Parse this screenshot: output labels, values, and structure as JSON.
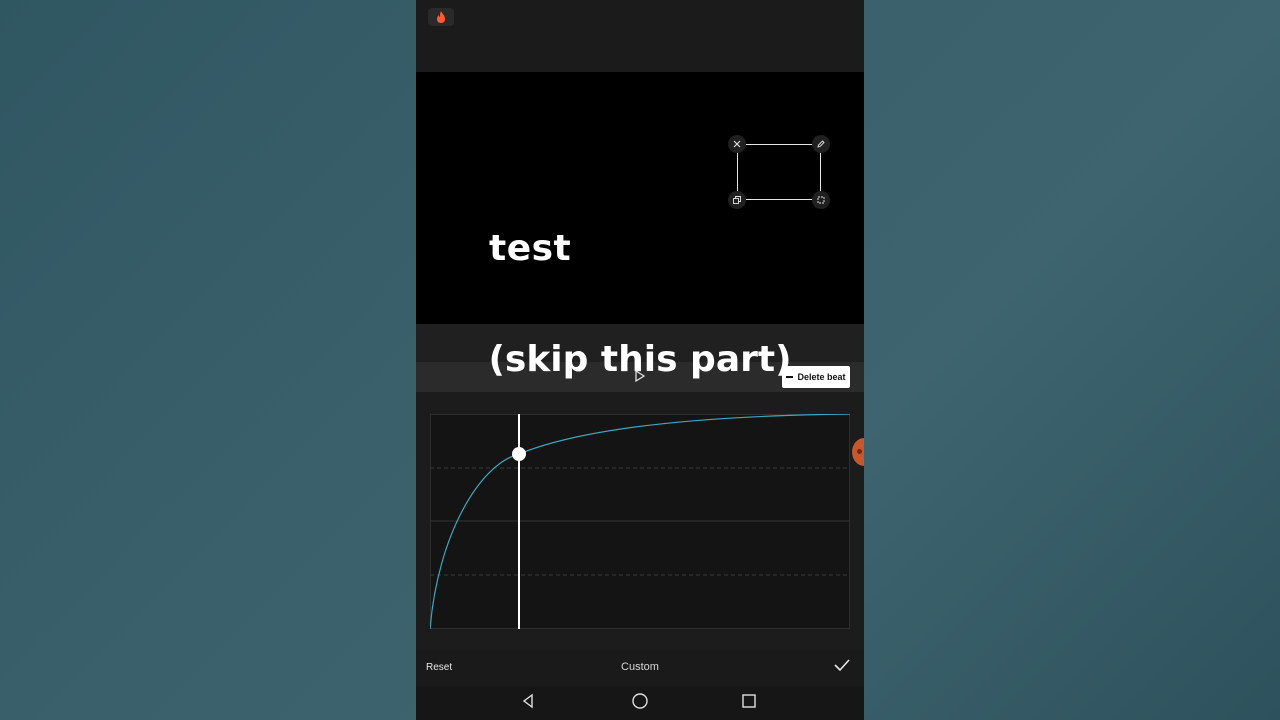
{
  "top_bar": {
    "icon": "fire-icon",
    "icon_color": "#ff5a3c"
  },
  "preview": {
    "text": "test",
    "selection_box_icons": [
      "close-icon",
      "edit-icon",
      "copy-icon",
      "resize-icon"
    ]
  },
  "caption": "(skip this part)",
  "beat_controls": {
    "play_icon": "play-icon",
    "delete_label": "Delete beat"
  },
  "speed_curve": {
    "curve_color": "#3fa7c0",
    "playhead_position": 0.21,
    "point_value": 0.81
  },
  "bottom_bar": {
    "reset_label": "Reset",
    "mode_label": "Custom",
    "confirm_icon": "check-icon"
  },
  "nav_bar": {
    "icons": [
      "back-icon",
      "home-icon",
      "recents-icon"
    ]
  }
}
